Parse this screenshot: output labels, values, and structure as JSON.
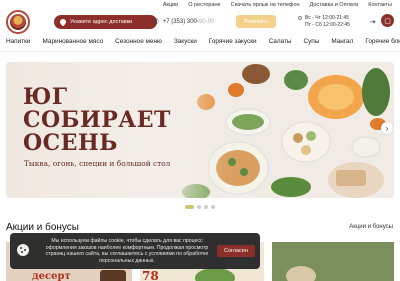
{
  "top_links": [
    "Акции",
    "О ресторане",
    "Скачать ярлык на телефон",
    "Доставка и Оплата",
    "Контакты"
  ],
  "header": {
    "address_button": "Укажите адрес доставки",
    "phone": "+7 (353) 300-",
    "phone_fade": "90-90",
    "call_button": "Позвонить",
    "hours_line1": "Вс - Чт 12:00-21:45",
    "hours_line2": "Пт - Сб 12:00-22:45"
  },
  "nav": [
    "Напитки",
    "Маринованное мясо",
    "Сезонное меню",
    "Закуски",
    "Горячие закуски",
    "Салаты",
    "Супы",
    "Мангал",
    "Горячие блюда"
  ],
  "hero": {
    "title_line1": "ЮГ",
    "title_line2": "СОБИРАЕТ",
    "title_line3": "ОСЕНЬ",
    "subtitle": "Тыква, огонь, специи и большой стол"
  },
  "section": {
    "title": "Акции и бонусы",
    "link": "Акции и бонусы"
  },
  "promos": {
    "promo1_text": "десерт",
    "promo2_text": "78"
  },
  "cookie": {
    "text": "Мы используем файлы cookie, чтобы сделать для вас процесс оформления заказов наиболее комфортным. Продолжая просмотр страниц нашего сайта, вы соглашаетесь с условиями по обработке персональных данных.",
    "button": "Согласен"
  },
  "colors": {
    "brand": "#8c2f2a",
    "hero_title": "#6a2a24",
    "call_button": "#f2d28b"
  }
}
